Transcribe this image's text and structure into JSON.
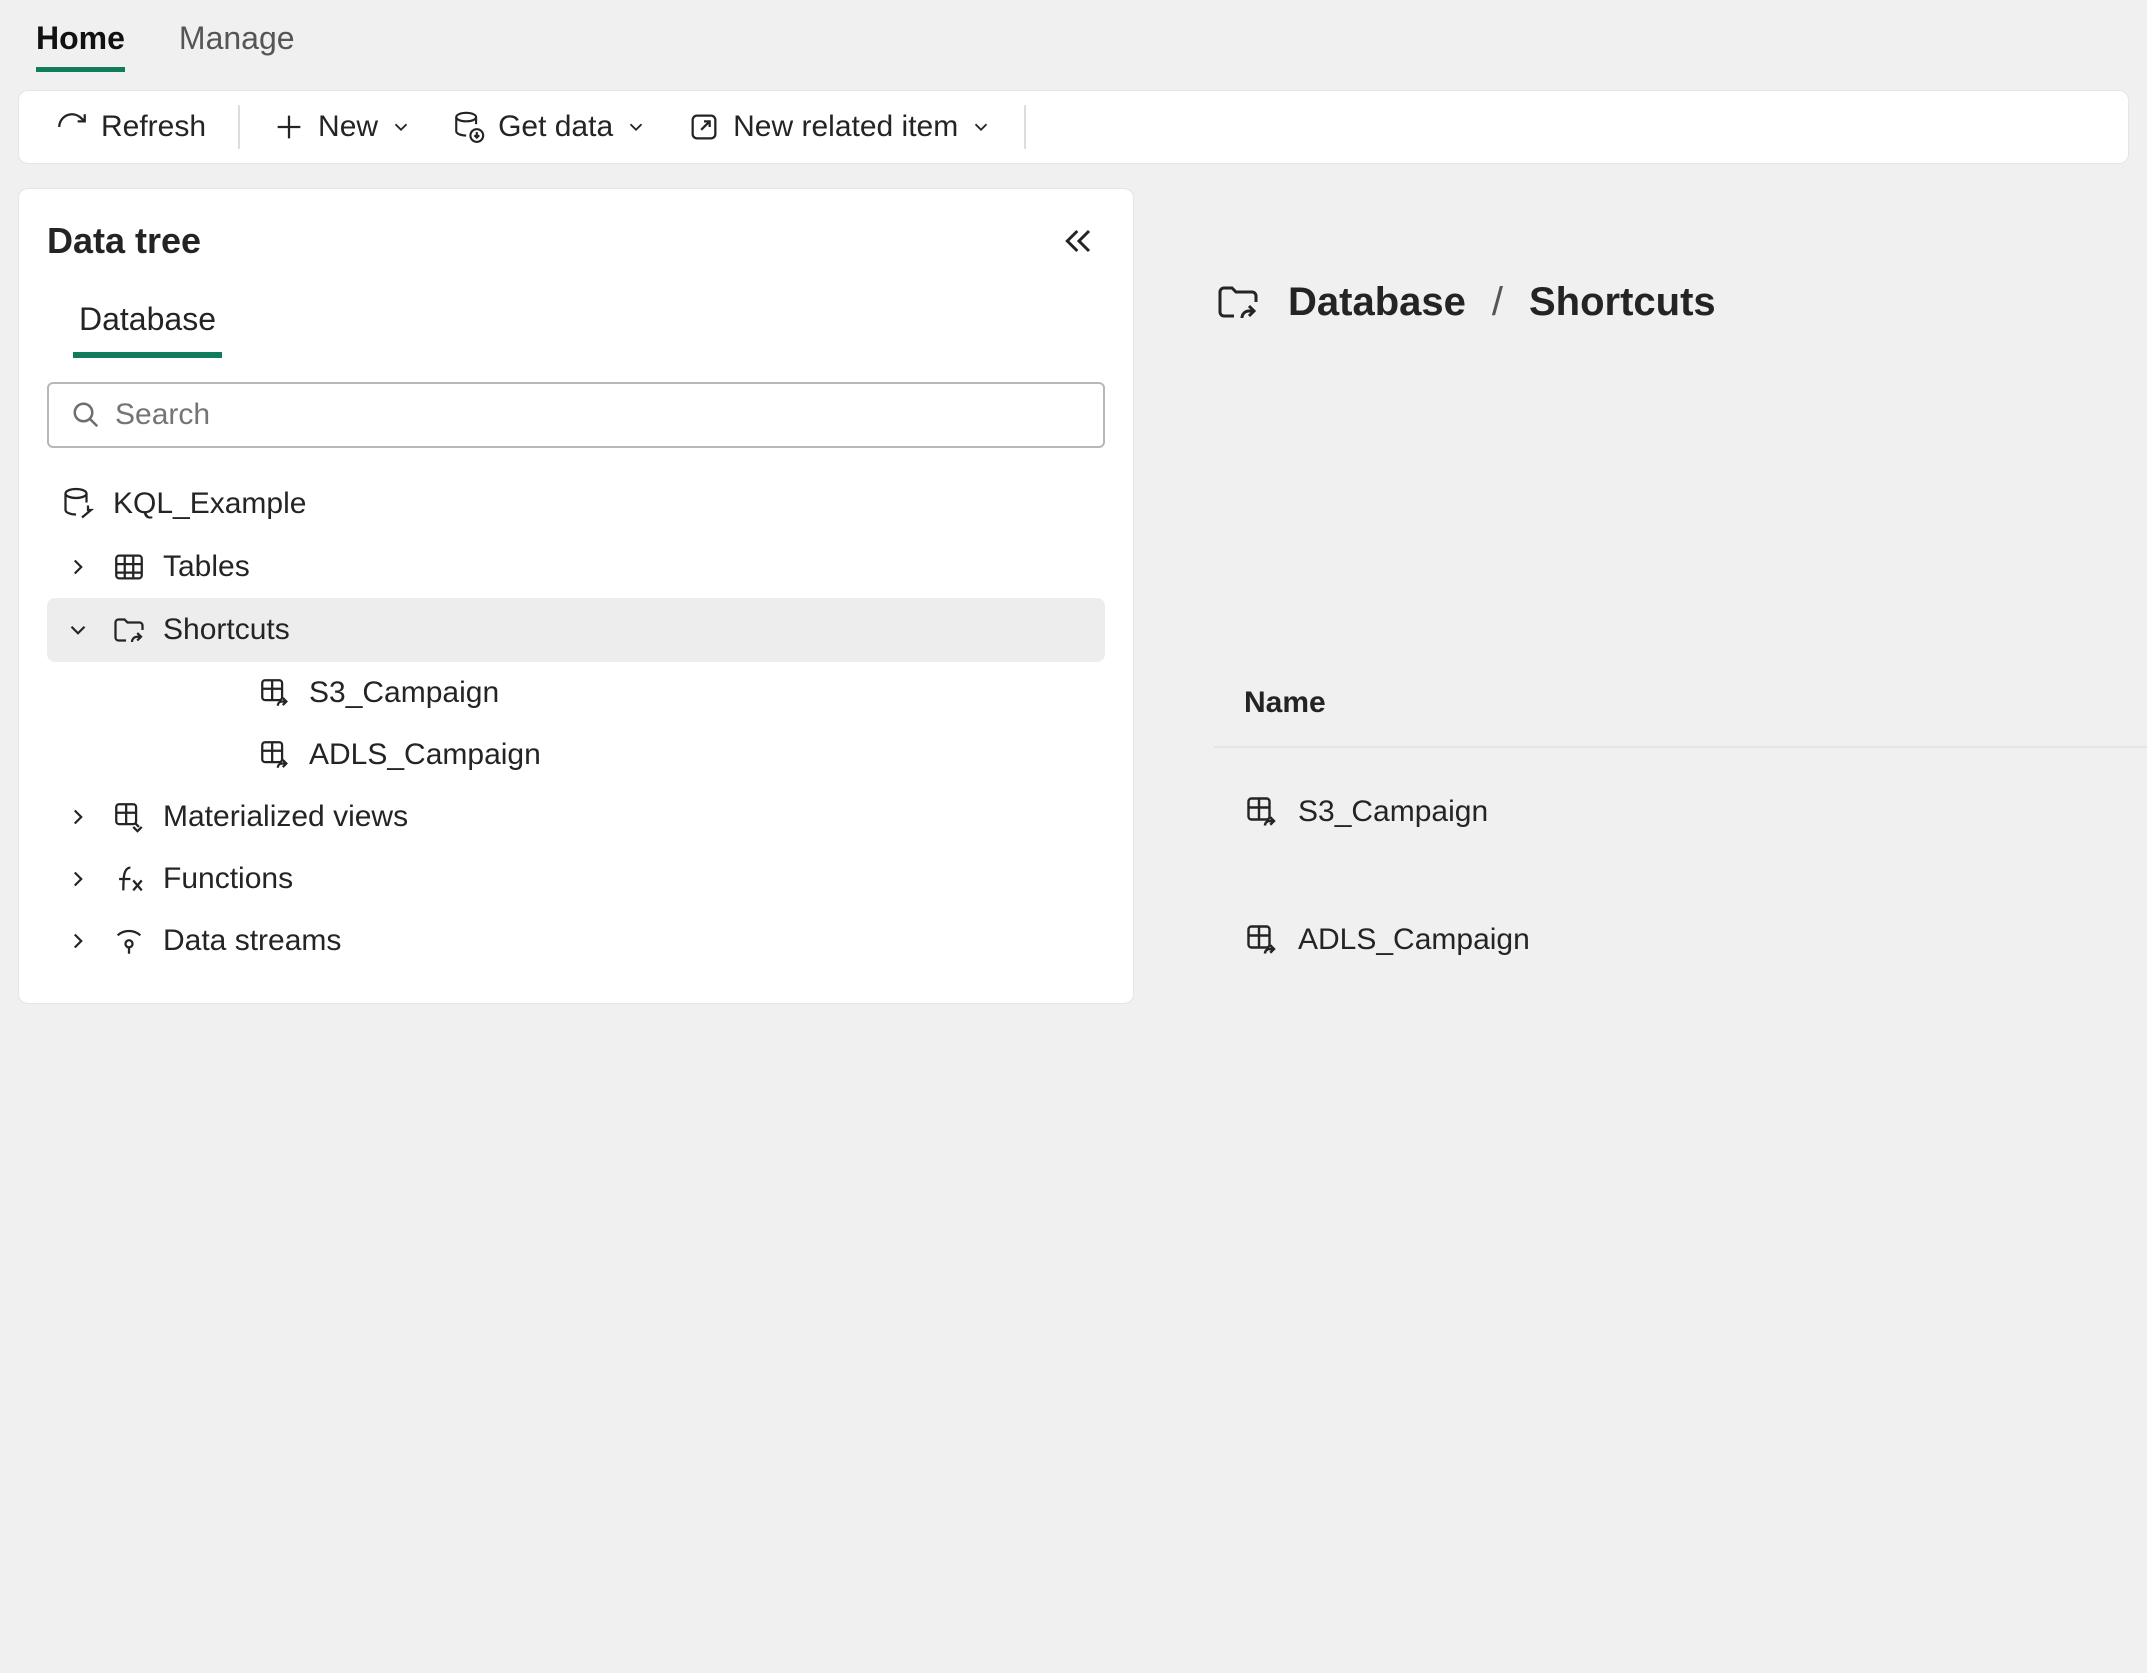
{
  "nav": {
    "tabs": [
      "Home",
      "Manage"
    ],
    "active": "Home"
  },
  "toolbar": {
    "refresh": "Refresh",
    "new": "New",
    "getdata": "Get data",
    "newrelated": "New related item"
  },
  "sidebar": {
    "title": "Data tree",
    "tab": "Database",
    "search_placeholder": "Search",
    "root": "KQL_Example",
    "nodes": {
      "tables": "Tables",
      "shortcuts": "Shortcuts",
      "matviews": "Materialized views",
      "functions": "Functions",
      "datastreams": "Data streams"
    },
    "shortcut_children": [
      "S3_Campaign",
      "ADLS_Campaign"
    ]
  },
  "content": {
    "breadcrumb": [
      "Database",
      "Shortcuts"
    ],
    "name_header": "Name",
    "items": [
      "S3_Campaign",
      "ADLS_Campaign"
    ]
  }
}
